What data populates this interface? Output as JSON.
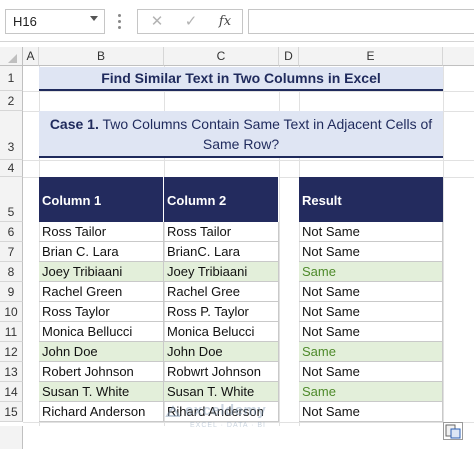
{
  "formula_bar": {
    "name_box": "H16",
    "cancel_icon": "✕",
    "enter_icon": "✓",
    "fx_label": "fx",
    "formula_value": ""
  },
  "columns": [
    "A",
    "B",
    "C",
    "D",
    "E"
  ],
  "rows": [
    "1",
    "2",
    "3",
    "4",
    "5",
    "6",
    "7",
    "8",
    "9",
    "10",
    "11",
    "12",
    "13",
    "14",
    "15"
  ],
  "title": "Find Similar Text in Two Columns in Excel",
  "case": {
    "bold_part": "Case 1.",
    "rest": " Two Columns Contain Same Text in Adjacent Cells of Same Row?"
  },
  "table": {
    "headers": [
      "Column 1",
      "Column 2",
      "Result"
    ],
    "rows": [
      {
        "c1": "Ross Tailor",
        "c2": "Ross Tailor",
        "result": "Not Same",
        "same": false
      },
      {
        "c1": "Brian C. Lara",
        "c2": "BrianC. Lara",
        "result": "Not Same",
        "same": false
      },
      {
        "c1": "Joey Tribiaani",
        "c2": "Joey Tribiaani",
        "result": "Same",
        "same": true
      },
      {
        "c1": "Rachel Green",
        "c2": "Rachel Gree",
        "result": "Not Same",
        "same": false
      },
      {
        "c1": "Ross Taylor",
        "c2": "Ross P. Taylor",
        "result": "Not Same",
        "same": false
      },
      {
        "c1": "Monica Bellucci",
        "c2": "Monica Belucci",
        "result": "Not Same",
        "same": false
      },
      {
        "c1": "John Doe",
        "c2": "John Doe",
        "result": "Same",
        "same": true
      },
      {
        "c1": "Robert Johnson",
        "c2": "Robwrt Johnson",
        "result": "Not Same",
        "same": false
      },
      {
        "c1": "Susan T. White",
        "c2": "Susan T. White",
        "result": "Same",
        "same": true
      },
      {
        "c1": "Richard Anderson",
        "c2": "Rihard Anderson",
        "result": "Not Same",
        "same": false
      }
    ]
  },
  "watermark": {
    "name": "exceldemy",
    "tagline": "EXCEL · DATA · BI"
  },
  "colors": {
    "header_fill": "#232b5e",
    "title_fill": "#dfe5f3",
    "match_fill": "#e3efda",
    "match_text": "#4e8a2a"
  }
}
